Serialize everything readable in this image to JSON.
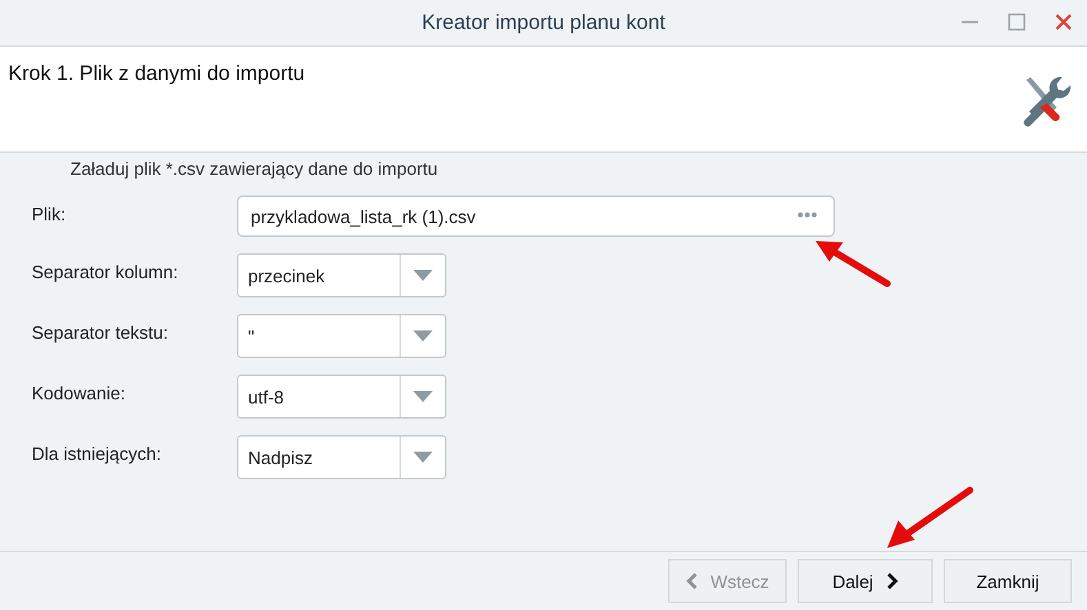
{
  "window": {
    "title": "Kreator importu planu kont"
  },
  "step": {
    "title": "Krok 1. Plik z danymi do importu"
  },
  "instruction": "Załaduj plik *.csv zawierający dane do importu",
  "fields": [
    {
      "kind": "file",
      "label": "Plik:",
      "value": "przykladowa_lista_rk (1).csv"
    },
    {
      "kind": "select",
      "label": "Separator kolumn:",
      "value": "przecinek"
    },
    {
      "kind": "select",
      "label": "Separator tekstu:",
      "value": "\""
    },
    {
      "kind": "select",
      "label": "Kodowanie:",
      "value": "utf-8"
    },
    {
      "kind": "select",
      "label": "Dla istniejących:",
      "value": "Nadpisz"
    }
  ],
  "buttons": [
    {
      "kind": "back",
      "label": "Wstecz",
      "disabled": true
    },
    {
      "kind": "next",
      "label": "Dalej",
      "disabled": false
    },
    {
      "kind": "plain",
      "label": "Zamknij",
      "disabled": false
    }
  ]
}
